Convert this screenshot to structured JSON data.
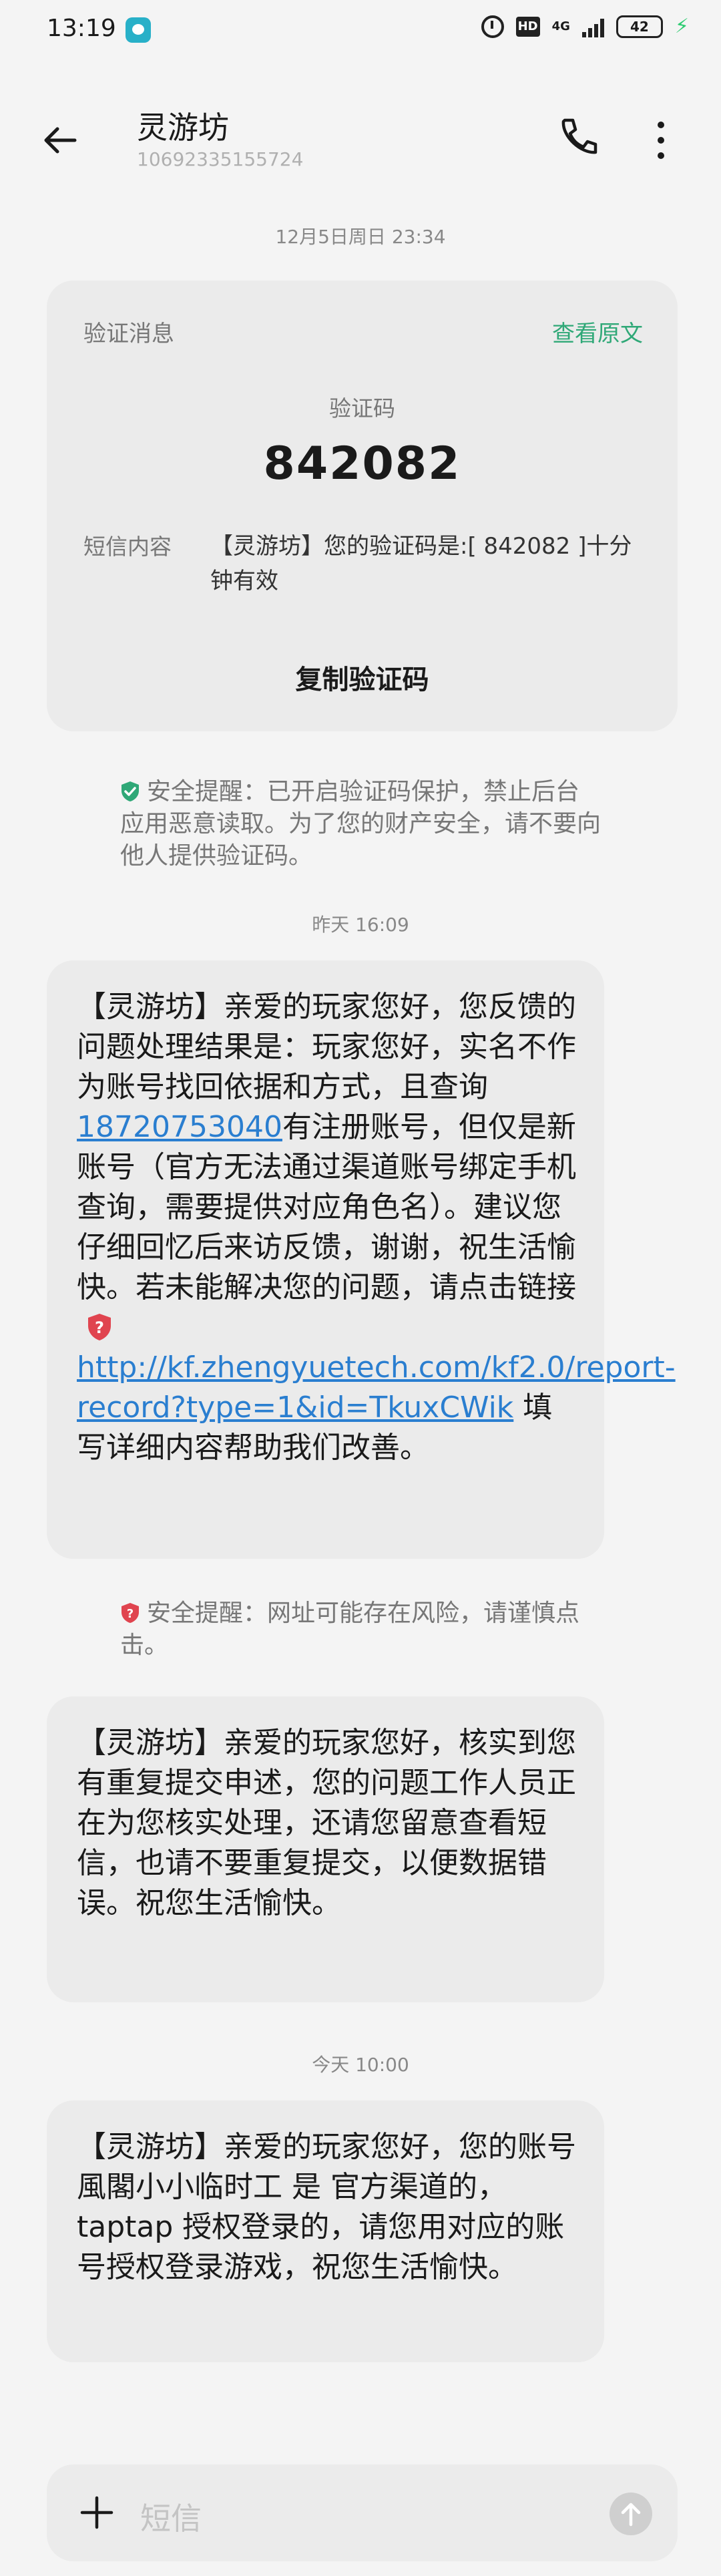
{
  "status_bar": {
    "time": "13:19",
    "network": "4G",
    "hd": "HD",
    "battery": "42"
  },
  "header": {
    "title": "灵游坊",
    "subtitle": "10692335155724"
  },
  "timestamps": [
    "12月5日周日 23:34",
    "昨天 16:09",
    "今天 10:00"
  ],
  "verification_card": {
    "label": "验证消息",
    "view_original": "查看原文",
    "code_label": "验证码",
    "code": "842082",
    "sms_label": "短信内容",
    "sms_text": "【灵游坊】您的验证码是:[ 842082 ]十分钟有效",
    "copy_button": "复制验证码"
  },
  "notice_verification": "安全提醒：已开启验证码保护，禁止后台应用恶意读取。为了您的财产安全，请不要向他人提供验证码。",
  "message1": {
    "part1": "【灵游坊】亲爱的玩家您好，您反馈的问题处理结果是：玩家您好，实名不作为账号找回依据和方式，且查询",
    "phone": "18720753040",
    "part2": "有注册账号，但仅是新账号（官方无法通过渠道账号绑定手机查询，需要提供对应角色名）。建议您仔细回忆后来访反馈，谢谢，祝生活愉快。若未能解决您的问题，请点击链接",
    "link": "http://kf.zhengyuetech.com/kf2.0/report-record?type=1&id=TkuxCWik",
    "part3": " 填写详细内容帮助我们改善。"
  },
  "notice_link": "安全提醒：网址可能存在风险，请谨慎点击。",
  "message2": "【灵游坊】亲爱的玩家您好，核实到您有重复提交申述，您的问题工作人员正在为您核实处理，还请您留意查看短信，也请不要重复提交，以便数据错误。祝您生活愉快。",
  "message3": "【灵游坊】亲爱的玩家您好，您的账号  風閣小小临时工  是   官方渠道的，taptap  授权登录的，请您用对应的账号授权登录游戏，祝您生活愉快。",
  "composer": {
    "placeholder": "短信"
  },
  "colors": {
    "accent_green": "#2fa877",
    "link_blue": "#2a7ed0",
    "warning_red": "#e0444f",
    "bubble_bg": "#ebebeb"
  }
}
